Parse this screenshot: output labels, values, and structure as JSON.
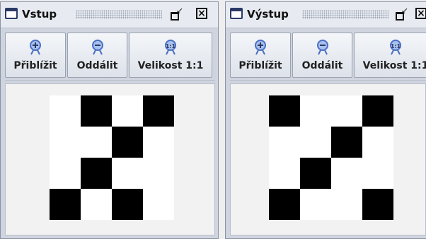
{
  "windows": [
    {
      "title": "Vstup",
      "toolbar": [
        "Přiblížit",
        "Oddálit",
        "Velikost 1:1"
      ],
      "icons": [
        "zoom-in-icon",
        "zoom-out-icon",
        "actual-size-icon"
      ],
      "grid": [
        [
          0,
          1,
          0,
          1
        ],
        [
          0,
          0,
          1,
          0
        ],
        [
          0,
          1,
          0,
          0
        ],
        [
          1,
          0,
          1,
          0
        ]
      ]
    },
    {
      "title": "Výstup",
      "toolbar": [
        "Přiblížit",
        "Oddálit",
        "Velikost 1:1"
      ],
      "icons": [
        "zoom-in-icon",
        "zoom-out-icon",
        "actual-size-icon"
      ],
      "grid": [
        [
          1,
          0,
          0,
          1
        ],
        [
          0,
          0,
          1,
          0
        ],
        [
          0,
          1,
          0,
          0
        ],
        [
          1,
          0,
          0,
          1
        ]
      ]
    }
  ],
  "colors": {
    "pixel_on": "#000000",
    "pixel_off": "#ffffff",
    "icon_blue": "#4b6fc4"
  }
}
